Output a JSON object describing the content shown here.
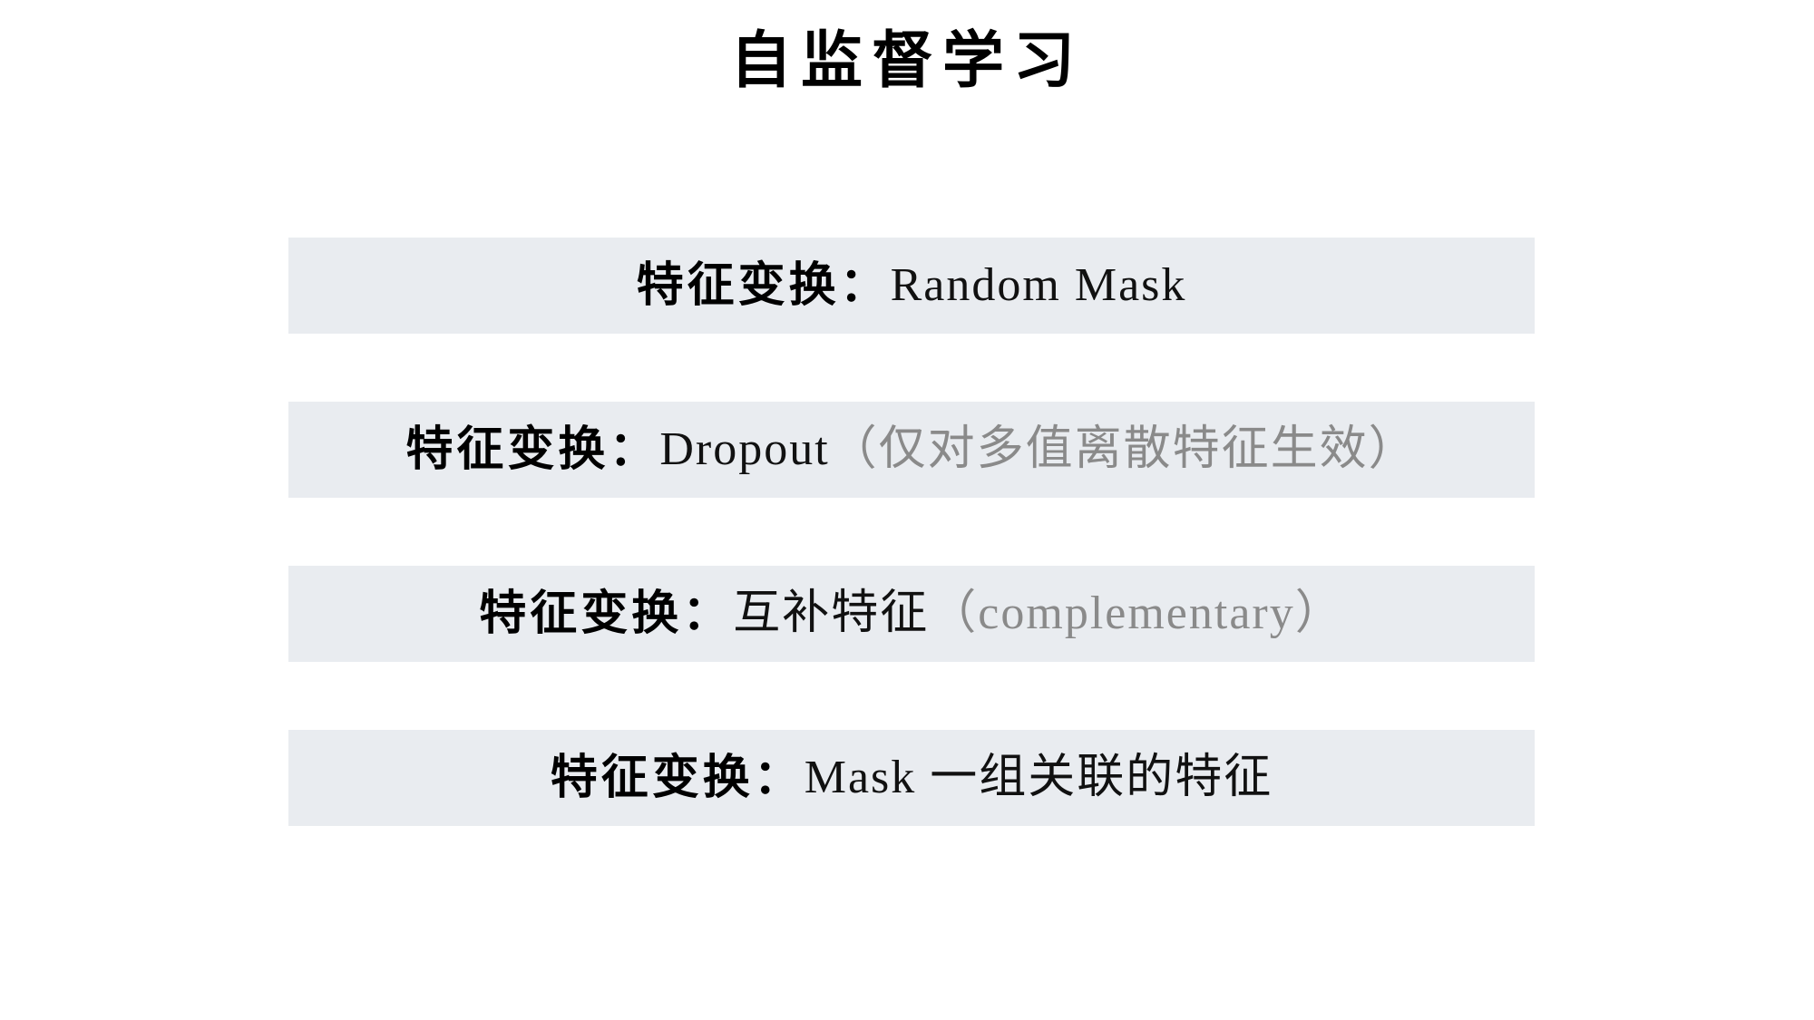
{
  "slide": {
    "title": "自监督学习"
  },
  "items": [
    {
      "prefix": "特征变换：",
      "text": "Random Mask",
      "note": ""
    },
    {
      "prefix": "特征变换：",
      "text": "Dropout",
      "note": "（仅对多值离散特征生效）"
    },
    {
      "prefix": "特征变换：",
      "text": "互补特征",
      "note": "（complementary）"
    },
    {
      "prefix": "特征变换：",
      "text": " Mask 一组关联的特征",
      "note": ""
    }
  ],
  "colors": {
    "bar_background": "#e9ecf0",
    "note_text": "#8a8a8a"
  }
}
